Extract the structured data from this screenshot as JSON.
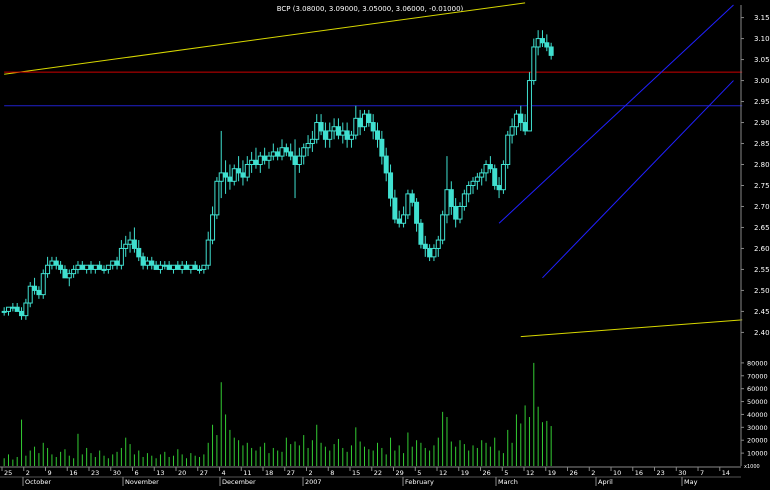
{
  "chart_data": {
    "type": "candlestick",
    "title": "BCP (3.08000, 3.09000, 3.05000, 3.06000, -0.01000)",
    "colors": {
      "background": "#000000",
      "candle": "#40e0d0",
      "volume": "#33cc33",
      "trendline_yellow": "#d8d800",
      "horizontal_red": "#cc0000",
      "horizontal_blue": "#2020cc",
      "channel_blue": "#2020ff",
      "axis_text": "#ffffff"
    },
    "price_axis": {
      "ticks": [
        2.4,
        2.45,
        2.5,
        2.55,
        2.6,
        2.65,
        2.7,
        2.75,
        2.8,
        2.85,
        2.9,
        2.95,
        3.0,
        3.05,
        3.1,
        3.15
      ],
      "tick_labels": [
        "2.40",
        "2.45",
        "2.50",
        "2.55",
        "2.60",
        "2.65",
        "2.70",
        "2.75",
        "2.80",
        "2.85",
        "2.90",
        "2.95",
        "3.00",
        "3.05",
        "3.10",
        "3.15"
      ],
      "range": [
        2.37,
        3.18
      ]
    },
    "volume_axis": {
      "ticks": [
        10000,
        20000,
        30000,
        40000,
        50000,
        60000,
        70000,
        80000
      ],
      "tick_labels": [
        "10000",
        "20000",
        "30000",
        "40000",
        "50000",
        "60000",
        "70000",
        "80000"
      ],
      "range": [
        0,
        90000
      ],
      "scale_note": "x1000"
    },
    "x_axis": {
      "day_labels": [
        "25",
        "2",
        "9",
        "16",
        "23",
        "30",
        "6",
        "13",
        "20",
        "27",
        "4",
        "11",
        "18",
        "27",
        "2",
        "8",
        "15",
        "22",
        "29",
        "5",
        "12",
        "19",
        "26",
        "5",
        "12",
        "19",
        "26",
        "2",
        "10",
        "16",
        "23",
        "30",
        "7",
        "14"
      ],
      "month_labels": [
        "October",
        "November",
        "December",
        "2007",
        "February",
        "March",
        "April",
        "May"
      ]
    },
    "candles": [
      [
        2.45,
        2.46,
        2.44,
        2.45
      ],
      [
        2.45,
        2.46,
        2.44,
        2.46
      ],
      [
        2.46,
        2.47,
        2.45,
        2.46
      ],
      [
        2.46,
        2.47,
        2.45,
        2.45
      ],
      [
        2.45,
        2.46,
        2.43,
        2.44
      ],
      [
        2.44,
        2.48,
        2.43,
        2.47
      ],
      [
        2.47,
        2.52,
        2.46,
        2.51
      ],
      [
        2.51,
        2.53,
        2.49,
        2.5
      ],
      [
        2.5,
        2.51,
        2.48,
        2.49
      ],
      [
        2.49,
        2.55,
        2.48,
        2.54
      ],
      [
        2.54,
        2.58,
        2.53,
        2.56
      ],
      [
        2.56,
        2.58,
        2.55,
        2.57
      ],
      [
        2.57,
        2.58,
        2.55,
        2.56
      ],
      [
        2.56,
        2.57,
        2.54,
        2.55
      ],
      [
        2.55,
        2.56,
        2.53,
        2.53
      ],
      [
        2.53,
        2.55,
        2.51,
        2.54
      ],
      [
        2.54,
        2.56,
        2.53,
        2.55
      ],
      [
        2.55,
        2.57,
        2.54,
        2.56
      ],
      [
        2.56,
        2.57,
        2.55,
        2.55
      ],
      [
        2.55,
        2.56,
        2.54,
        2.56
      ],
      [
        2.56,
        2.57,
        2.54,
        2.55
      ],
      [
        2.55,
        2.56,
        2.54,
        2.56
      ],
      [
        2.56,
        2.57,
        2.55,
        2.55
      ],
      [
        2.55,
        2.56,
        2.54,
        2.55
      ],
      [
        2.55,
        2.56,
        2.54,
        2.56
      ],
      [
        2.56,
        2.57,
        2.55,
        2.57
      ],
      [
        2.57,
        2.58,
        2.55,
        2.56
      ],
      [
        2.56,
        2.62,
        2.55,
        2.6
      ],
      [
        2.6,
        2.63,
        2.58,
        2.61
      ],
      [
        2.61,
        2.64,
        2.59,
        2.62
      ],
      [
        2.62,
        2.65,
        2.59,
        2.6
      ],
      [
        2.6,
        2.62,
        2.57,
        2.58
      ],
      [
        2.58,
        2.59,
        2.55,
        2.56
      ],
      [
        2.56,
        2.58,
        2.55,
        2.57
      ],
      [
        2.57,
        2.58,
        2.55,
        2.56
      ],
      [
        2.56,
        2.57,
        2.55,
        2.55
      ],
      [
        2.55,
        2.57,
        2.54,
        2.56
      ],
      [
        2.56,
        2.57,
        2.55,
        2.56
      ],
      [
        2.56,
        2.57,
        2.55,
        2.55
      ],
      [
        2.55,
        2.56,
        2.54,
        2.56
      ],
      [
        2.56,
        2.57,
        2.55,
        2.55
      ],
      [
        2.55,
        2.57,
        2.54,
        2.56
      ],
      [
        2.56,
        2.57,
        2.55,
        2.55
      ],
      [
        2.55,
        2.56,
        2.54,
        2.56
      ],
      [
        2.56,
        2.57,
        2.55,
        2.55
      ],
      [
        2.55,
        2.56,
        2.54,
        2.55
      ],
      [
        2.55,
        2.56,
        2.54,
        2.56
      ],
      [
        2.56,
        2.64,
        2.55,
        2.62
      ],
      [
        2.62,
        2.7,
        2.61,
        2.68
      ],
      [
        2.68,
        2.77,
        2.67,
        2.76
      ],
      [
        2.76,
        2.88,
        2.72,
        2.78
      ],
      [
        2.78,
        2.81,
        2.73,
        2.77
      ],
      [
        2.77,
        2.8,
        2.74,
        2.76
      ],
      [
        2.76,
        2.8,
        2.75,
        2.79
      ],
      [
        2.79,
        2.82,
        2.76,
        2.78
      ],
      [
        2.78,
        2.81,
        2.75,
        2.77
      ],
      [
        2.77,
        2.82,
        2.76,
        2.8
      ],
      [
        2.8,
        2.83,
        2.78,
        2.81
      ],
      [
        2.81,
        2.84,
        2.79,
        2.8
      ],
      [
        2.8,
        2.83,
        2.78,
        2.82
      ],
      [
        2.82,
        2.84,
        2.8,
        2.81
      ],
      [
        2.81,
        2.83,
        2.79,
        2.82
      ],
      [
        2.82,
        2.85,
        2.81,
        2.83
      ],
      [
        2.83,
        2.84,
        2.81,
        2.82
      ],
      [
        2.82,
        2.86,
        2.81,
        2.84
      ],
      [
        2.84,
        2.85,
        2.82,
        2.83
      ],
      [
        2.83,
        2.85,
        2.81,
        2.82
      ],
      [
        2.82,
        2.86,
        2.72,
        2.8
      ],
      [
        2.8,
        2.84,
        2.78,
        2.82
      ],
      [
        2.82,
        2.85,
        2.8,
        2.84
      ],
      [
        2.84,
        2.87,
        2.82,
        2.85
      ],
      [
        2.85,
        2.88,
        2.83,
        2.86
      ],
      [
        2.86,
        2.92,
        2.85,
        2.9
      ],
      [
        2.9,
        2.92,
        2.87,
        2.88
      ],
      [
        2.88,
        2.9,
        2.84,
        2.86
      ],
      [
        2.86,
        2.9,
        2.84,
        2.88
      ],
      [
        2.88,
        2.91,
        2.86,
        2.89
      ],
      [
        2.89,
        2.91,
        2.86,
        2.87
      ],
      [
        2.87,
        2.9,
        2.85,
        2.88
      ],
      [
        2.88,
        2.9,
        2.84,
        2.86
      ],
      [
        2.86,
        2.88,
        2.84,
        2.87
      ],
      [
        2.87,
        2.94,
        2.86,
        2.91
      ],
      [
        2.91,
        2.93,
        2.87,
        2.89
      ],
      [
        2.89,
        2.93,
        2.88,
        2.92
      ],
      [
        2.92,
        2.93,
        2.89,
        2.9
      ],
      [
        2.9,
        2.92,
        2.86,
        2.88
      ],
      [
        2.88,
        2.9,
        2.84,
        2.86
      ],
      [
        2.86,
        2.88,
        2.8,
        2.82
      ],
      [
        2.82,
        2.84,
        2.76,
        2.78
      ],
      [
        2.78,
        2.8,
        2.7,
        2.72
      ],
      [
        2.72,
        2.74,
        2.66,
        2.67
      ],
      [
        2.67,
        2.69,
        2.65,
        2.66
      ],
      [
        2.66,
        2.7,
        2.65,
        2.68
      ],
      [
        2.68,
        2.74,
        2.67,
        2.73
      ],
      [
        2.73,
        2.74,
        2.7,
        2.71
      ],
      [
        2.71,
        2.72,
        2.64,
        2.66
      ],
      [
        2.66,
        2.67,
        2.6,
        2.61
      ],
      [
        2.61,
        2.63,
        2.58,
        2.6
      ],
      [
        2.6,
        2.61,
        2.57,
        2.58
      ],
      [
        2.58,
        2.61,
        2.57,
        2.6
      ],
      [
        2.6,
        2.63,
        2.58,
        2.62
      ],
      [
        2.62,
        2.69,
        2.61,
        2.68
      ],
      [
        2.68,
        2.82,
        2.66,
        2.74
      ],
      [
        2.74,
        2.76,
        2.68,
        2.7
      ],
      [
        2.7,
        2.72,
        2.65,
        2.67
      ],
      [
        2.67,
        2.71,
        2.66,
        2.7
      ],
      [
        2.7,
        2.74,
        2.69,
        2.73
      ],
      [
        2.73,
        2.76,
        2.71,
        2.75
      ],
      [
        2.75,
        2.77,
        2.73,
        2.76
      ],
      [
        2.76,
        2.78,
        2.74,
        2.77
      ],
      [
        2.77,
        2.79,
        2.75,
        2.78
      ],
      [
        2.78,
        2.81,
        2.76,
        2.8
      ],
      [
        2.8,
        2.82,
        2.78,
        2.79
      ],
      [
        2.79,
        2.8,
        2.74,
        2.75
      ],
      [
        2.75,
        2.77,
        2.72,
        2.74
      ],
      [
        2.74,
        2.81,
        2.73,
        2.8
      ],
      [
        2.8,
        2.88,
        2.79,
        2.87
      ],
      [
        2.87,
        2.91,
        2.85,
        2.89
      ],
      [
        2.89,
        2.93,
        2.87,
        2.92
      ],
      [
        2.92,
        2.94,
        2.88,
        2.9
      ],
      [
        2.9,
        2.92,
        2.87,
        2.88
      ],
      [
        2.88,
        3.02,
        2.98,
        3.0
      ],
      [
        3.0,
        3.1,
        2.99,
        3.08
      ],
      [
        3.08,
        3.12,
        3.06,
        3.1
      ],
      [
        3.1,
        3.12,
        3.08,
        3.09
      ],
      [
        3.09,
        3.11,
        3.07,
        3.08
      ],
      [
        3.08,
        3.09,
        3.05,
        3.06
      ]
    ],
    "volumes": [
      6000,
      9000,
      5000,
      7000,
      36000,
      8000,
      12000,
      15000,
      10000,
      18000,
      14000,
      9000,
      7000,
      11000,
      13000,
      8000,
      6000,
      25000,
      9000,
      14000,
      10000,
      7000,
      12000,
      8000,
      6000,
      9000,
      11000,
      14000,
      22000,
      17000,
      9000,
      12000,
      7000,
      10000,
      8000,
      6000,
      9000,
      11000,
      7000,
      8000,
      13000,
      9000,
      6000,
      10000,
      8000,
      7000,
      9000,
      18000,
      32000,
      24000,
      65000,
      40000,
      28000,
      22000,
      20000,
      16000,
      18000,
      14000,
      12000,
      15000,
      18000,
      10000,
      14000,
      12000,
      11000,
      22000,
      17000,
      19000,
      16000,
      24000,
      14000,
      20000,
      32000,
      18000,
      15000,
      12000,
      17000,
      21000,
      14000,
      11000,
      16000,
      30000,
      19000,
      15000,
      13000,
      12000,
      18000,
      14000,
      9000,
      22000,
      12000,
      16000,
      10000,
      26000,
      15000,
      20000,
      18000,
      14000,
      12000,
      16000,
      22000,
      42000,
      38000,
      19000,
      15000,
      20000,
      17000,
      12000,
      16000,
      14000,
      20000,
      18000,
      15000,
      22000,
      12000,
      10000,
      28000,
      18000,
      40000,
      33000,
      47000,
      38000,
      80000,
      46000,
      34000,
      35000,
      31000
    ],
    "trendlines": [
      {
        "color": "yellow",
        "from": [
          0,
          3.015
        ],
        "to": [
          120,
          3.185
        ]
      },
      {
        "color": "yellow",
        "from": [
          119,
          2.39
        ],
        "to": [
          170,
          2.43
        ]
      },
      {
        "color": "red",
        "from": [
          0,
          3.02
        ],
        "to": [
          170,
          3.02
        ]
      },
      {
        "color": "blue",
        "from": [
          0,
          2.94
        ],
        "to": [
          170,
          2.94
        ]
      },
      {
        "color": "channel",
        "from": [
          114,
          2.66
        ],
        "to": [
          168,
          3.18
        ]
      },
      {
        "color": "channel",
        "from": [
          124,
          2.53
        ],
        "to": [
          168,
          3.0
        ]
      }
    ]
  }
}
